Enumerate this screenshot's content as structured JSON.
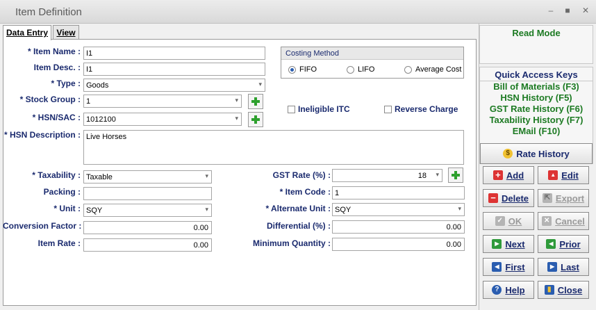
{
  "window": {
    "title": "Item Definition",
    "minimize": "–",
    "maximize": "■",
    "close": "✕"
  },
  "tabs": {
    "data_entry": "Data Entry",
    "view": "View"
  },
  "form": {
    "item_name": {
      "label": "* Item Name :",
      "value": "I1"
    },
    "item_desc": {
      "label": "Item Desc. :",
      "value": "I1"
    },
    "type": {
      "label": "* Type :",
      "value": "Goods"
    },
    "stock_group": {
      "label": "* Stock Group :",
      "value": "1"
    },
    "hsn_sac": {
      "label": "* HSN/SAC :",
      "value": "1012100"
    },
    "hsn_description": {
      "label": "* HSN Description :",
      "value": "Live Horses"
    },
    "taxability": {
      "label": "* Taxability :",
      "value": "Taxable"
    },
    "packing": {
      "label": "Packing :",
      "value": ""
    },
    "unit": {
      "label": "* Unit :",
      "value": "SQY"
    },
    "conversion_factor": {
      "label": "Conversion Factor :",
      "value": "0.00"
    },
    "item_rate": {
      "label": "Item Rate :",
      "value": "0.00"
    },
    "gst_rate": {
      "label": "GST Rate (%) :",
      "value": "18"
    },
    "item_code": {
      "label": "* Item Code :",
      "value": "1"
    },
    "alternate_unit": {
      "label": "* Alternate Unit :",
      "value": "SQY"
    },
    "differential": {
      "label": "Differential (%) :",
      "value": "0.00"
    },
    "minimum_quantity": {
      "label": "Minimum Quantity :",
      "value": "0.00"
    },
    "costing_method": {
      "title": "Costing Method",
      "options": [
        "FIFO",
        "LIFO",
        "Average Cost"
      ],
      "selected": "FIFO"
    },
    "ineligible_itc": "Ineligible ITC",
    "reverse_charge": "Reverse Charge"
  },
  "sidebar": {
    "mode": "Read Mode",
    "quick_access_title": "Quick Access Keys",
    "quick_access": [
      "Bill of Materials (F3)",
      "HSN History (F5)",
      "GST Rate History (F6)",
      "Taxability History (F7)",
      "EMail (F10)"
    ],
    "buttons": {
      "rate_history": "Rate History",
      "add": "Add",
      "edit": "Edit",
      "delete": "Delete",
      "export": "Export",
      "ok": "OK",
      "cancel": "Cancel",
      "next": "Next",
      "prior": "Prior",
      "first": "First",
      "last": "Last",
      "help": "Help",
      "close": "Close"
    }
  }
}
